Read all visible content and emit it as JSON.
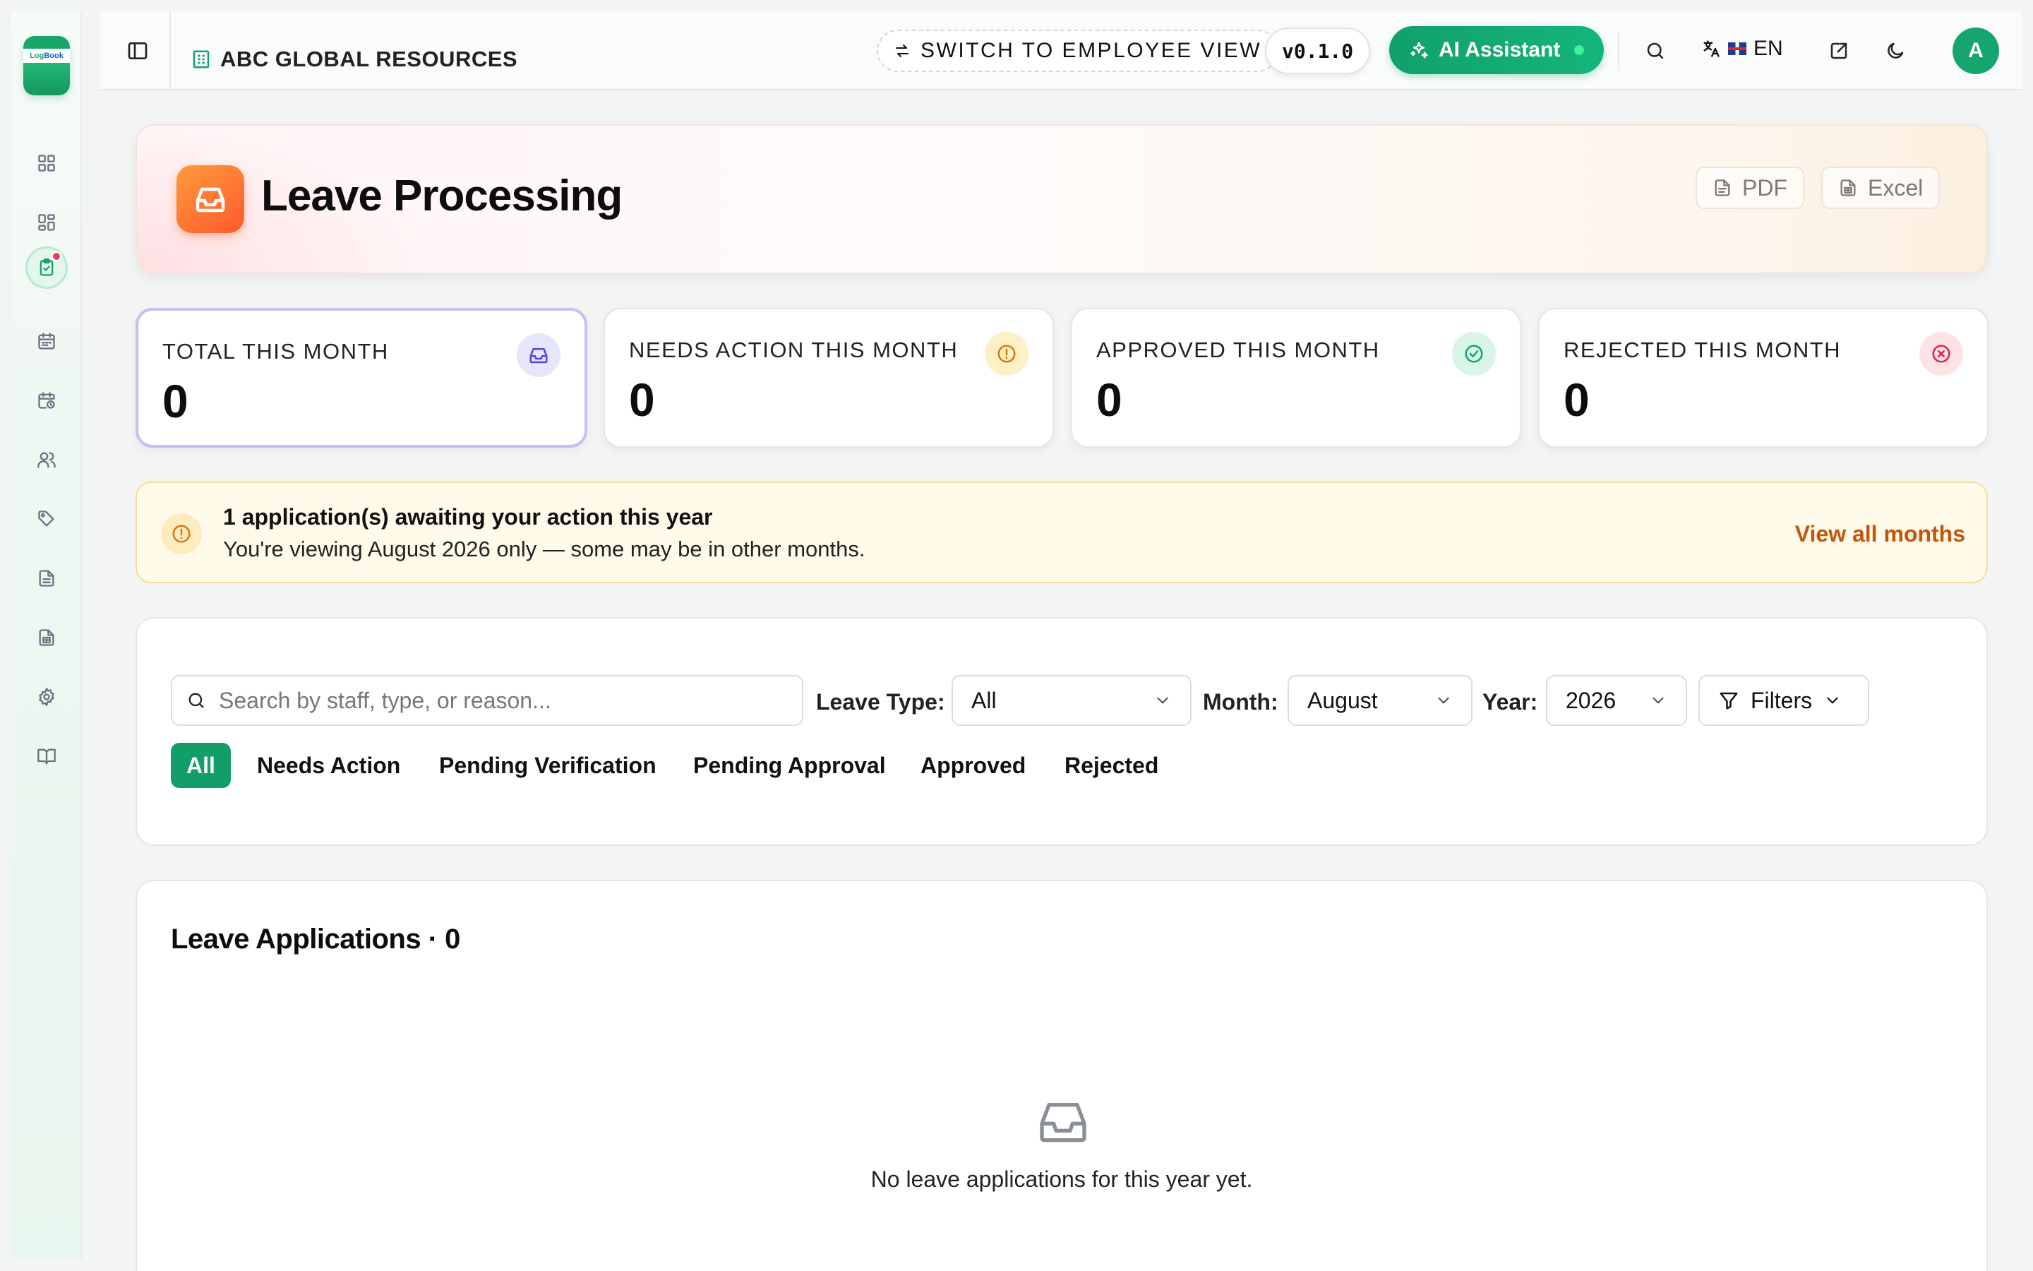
{
  "app": {
    "logo_text_a": "Log",
    "logo_text_b": "Book"
  },
  "topbar": {
    "company": "ABC GLOBAL RESOURCES",
    "switch_view": "SWITCH TO EMPLOYEE VIEW",
    "version": "v0.1.0",
    "ai_assistant": "AI Assistant",
    "language": "EN",
    "avatar_initial": "A"
  },
  "sidebar": {
    "items": [
      {
        "icon": "dashboard-grid-icon"
      },
      {
        "icon": "apps-grid-icon"
      },
      {
        "icon": "clipboard-check-icon",
        "active": true
      },
      {
        "icon": "calendar-icon"
      },
      {
        "icon": "calendar-clock-icon"
      },
      {
        "icon": "users-icon"
      },
      {
        "icon": "tags-icon"
      },
      {
        "icon": "document-icon"
      },
      {
        "icon": "spreadsheet-icon"
      },
      {
        "icon": "settings-gear-icon"
      },
      {
        "icon": "book-open-icon"
      }
    ]
  },
  "header": {
    "title": "Leave Processing",
    "pdf_label": "PDF",
    "excel_label": "Excel"
  },
  "stats": [
    {
      "label": "TOTAL THIS MONTH",
      "value": "0",
      "color": "#6366f1"
    },
    {
      "label": "NEEDS ACTION THIS MONTH",
      "value": "0",
      "color": "#d97706"
    },
    {
      "label": "APPROVED THIS MONTH",
      "value": "0",
      "color": "#10a36a"
    },
    {
      "label": "REJECTED THIS MONTH",
      "value": "0",
      "color": "#e11d48"
    }
  ],
  "alert": {
    "title": "1 application(s) awaiting your action this year",
    "message": "You're viewing August 2026 only — some may be in other months.",
    "link": "View all months"
  },
  "filters": {
    "search_placeholder": "Search by staff, type, or reason...",
    "leave_type_label": "Leave Type:",
    "leave_type_value": "All",
    "month_label": "Month:",
    "month_value": "August",
    "year_label": "Year:",
    "year_value": "2026",
    "filters_button": "Filters",
    "tabs": [
      "All",
      "Needs Action",
      "Pending Verification",
      "Pending Approval",
      "Approved",
      "Rejected"
    ],
    "active_tab": "All"
  },
  "applications": {
    "title": "Leave Applications · 0",
    "empty_text": "No leave applications for this year yet."
  },
  "colors": {
    "brand": "#129e69",
    "accent_orange": "#ff6a2c",
    "link_orange": "#c2560a"
  }
}
